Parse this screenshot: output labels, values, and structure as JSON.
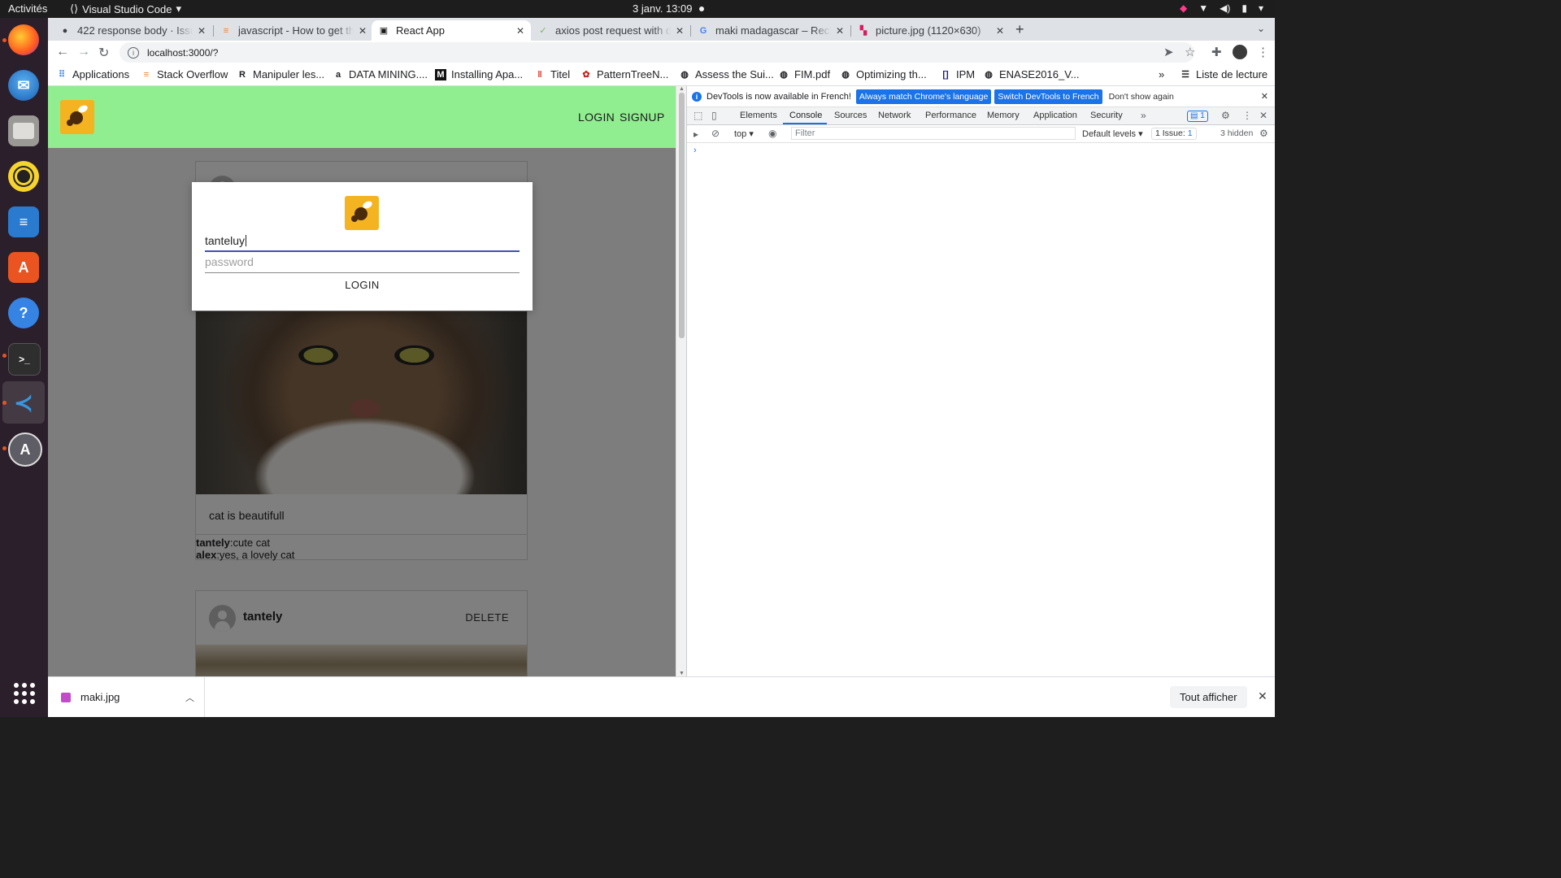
{
  "topbar": {
    "activities": "Activités",
    "app_name": "Visual Studio Code",
    "clock": "3 janv.  13:09"
  },
  "dock": {
    "items": [
      "firefox-icon",
      "thunderbird-icon",
      "files-icon",
      "rhythmbox-icon",
      "writer-icon",
      "software-icon",
      "help-icon",
      "terminal-icon",
      "vscode-icon",
      "updater-icon"
    ]
  },
  "browser": {
    "tabs": [
      {
        "title": "422 response body · Issue",
        "icon": "github-icon"
      },
      {
        "title": "javascript - How to get th",
        "icon": "stackoverflow-icon"
      },
      {
        "title": "React App",
        "icon": "react-icon"
      },
      {
        "title": "axios post request with d",
        "icon": "bookmark-icon"
      },
      {
        "title": "maki madagascar – Reche",
        "icon": "google-icon"
      },
      {
        "title": "picture.jpg (1120×630)",
        "icon": "image-icon"
      }
    ],
    "url": "localhost:3000/?",
    "bookmarks": [
      "Applications",
      "Stack Overflow",
      "Manipuler les...",
      "DATA MINING....",
      "Installing Apa...",
      "Titel",
      "PatternTreeN...",
      "Assess the Sui...",
      "FIM.pdf",
      "Optimizing th...",
      "IPM",
      "ENASE2016_V..."
    ],
    "reading_list": "Liste de lecture"
  },
  "app": {
    "nav_login": "LOGIN",
    "nav_signup": "SIGNUP",
    "modal": {
      "username_value": "tanteluy",
      "password_placeholder": "password",
      "submit_label": "LOGIN"
    },
    "posts": [
      {
        "caption": "cat is beautifull",
        "comments": [
          {
            "user": "tantely",
            "text": ":cute cat"
          },
          {
            "user": "alex",
            "text": ":yes, a lovely cat"
          }
        ]
      },
      {
        "user": "tantely",
        "delete_label": "DELETE"
      }
    ]
  },
  "devtools": {
    "info_message": "DevTools is now available in French!",
    "btn_match": "Always match Chrome's language",
    "btn_switch": "Switch DevTools to French",
    "btn_dismiss": "Don't show again",
    "tabs": [
      "Elements",
      "Console",
      "Sources",
      "Network",
      "Performance",
      "Memory",
      "Application",
      "Security"
    ],
    "active_tab": "Console",
    "messages_badge": "1",
    "context": "top",
    "filter_placeholder": "Filter",
    "levels": "Default levels",
    "issues_label": "1 Issue:",
    "issues_count": "1",
    "hidden": "3 hidden"
  },
  "downloads": {
    "file": "maki.jpg",
    "show_all": "Tout afficher"
  },
  "colors": {
    "app_header": "#90ee90",
    "accent": "#1a73e8",
    "input_focus": "#3f51b5"
  }
}
